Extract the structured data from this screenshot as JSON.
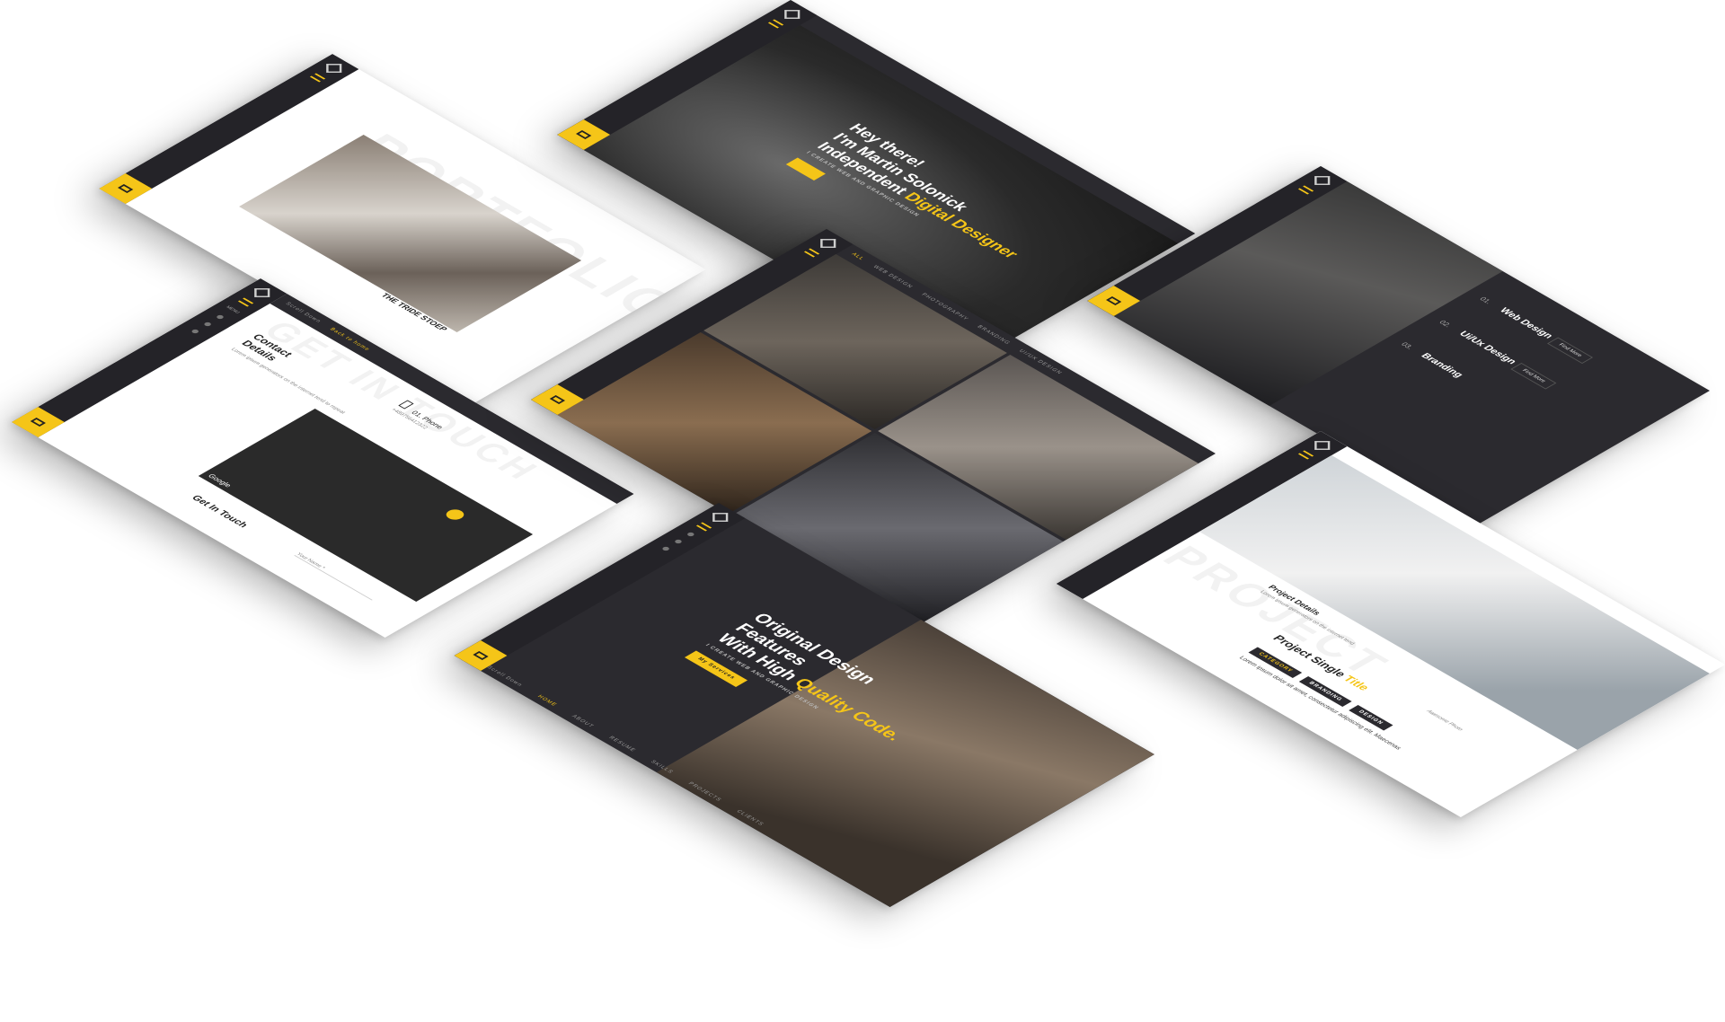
{
  "screens": {
    "hero_top": {
      "line1": "Hey there!",
      "line2": "I'm Martin Solonick",
      "line3_prefix": "Independent ",
      "line3_highlight": "Digital Designer",
      "subtitle": "I create web and graphic design"
    },
    "portfolio": {
      "watermark": "PORTFOLIO",
      "caption": "THE TRIDE STOEP"
    },
    "services": {
      "items": [
        {
          "num": "01.",
          "title": "Web Design",
          "btn": "Find More"
        },
        {
          "num": "02.",
          "title": "Ui/Ux Design",
          "btn": "Find More"
        },
        {
          "num": "03.",
          "title": "Branding"
        }
      ]
    },
    "contact": {
      "watermark": "GET IN TOUCH",
      "back_label": "Back to home",
      "scroll_label": "Scroll Down",
      "menu_label": "MENU",
      "title_line1": "Contact",
      "title_line2": "Details",
      "desc": "Lorem ipsum generators on the internet tend to repeat",
      "phone_label": "01. Phone",
      "phone_value": "+489756412322",
      "map_label": "Google",
      "form_title": "Get In Touch",
      "name_placeholder": "Your Name *"
    },
    "gallery": {
      "nav": [
        "ALL",
        "WEB DESIGN",
        "PHOTOGRAPHY",
        "BRANDING",
        "UI/UX DESIGN"
      ]
    },
    "hero_bottom": {
      "line1": "Original Design",
      "line2": "Features",
      "line3_prefix": "With High ",
      "line3_highlight": "Quality Code.",
      "subtitle": "I create web and graphic design",
      "cta": "My Services",
      "nav": [
        "HOME",
        "ABOUT",
        "RESUME",
        "SKILLS",
        "PROJECTS",
        "CLIENTS"
      ],
      "scroll_label": "Scroll Down"
    },
    "project": {
      "watermark": "PROJECT",
      "details_title": "Project Details",
      "details_desc": "Lorem ipsum generators on the internet tend",
      "title_prefix": "Project Single ",
      "title_highlight": "Title",
      "photo_caption": "Awesome Photo",
      "tags": [
        "CATEGORY",
        "BRANDING",
        "DESIGN"
      ],
      "body": "Lorem ipsum dolor sit amet, consectetur adipiscing elit. Maecenas"
    }
  },
  "colors": {
    "accent": "#f5c518",
    "dark": "#2b2a2f",
    "sidebar": "#242328"
  }
}
